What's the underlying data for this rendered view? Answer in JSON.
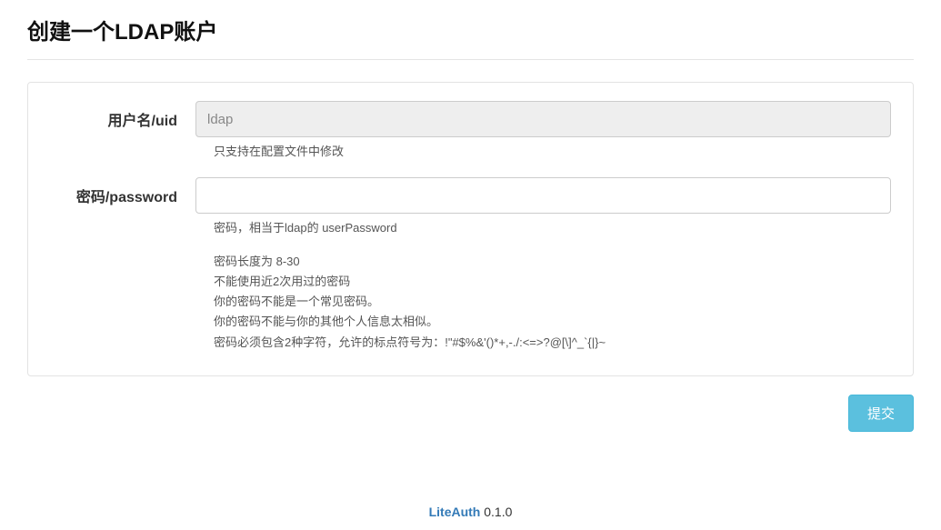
{
  "page": {
    "title": "创建一个LDAP账户"
  },
  "form": {
    "uid": {
      "label": "用户名/uid",
      "value": "ldap",
      "help": "只支持在配置文件中修改"
    },
    "password": {
      "label": "密码/password",
      "value": "",
      "help": "密码，相当于ldap的 userPassword",
      "rules": [
        "密码长度为 8-30",
        "不能使用近2次用过的密码",
        "你的密码不能是一个常见密码。",
        "你的密码不能与你的其他个人信息太相似。",
        "密码必须包含2种字符，允许的标点符号为：!\"#$%&'()*+,-./:<=>?@[\\]^_`{|}~"
      ]
    }
  },
  "actions": {
    "submit": "提交"
  },
  "footer": {
    "brand": "LiteAuth",
    "version": " 0.1.0"
  }
}
